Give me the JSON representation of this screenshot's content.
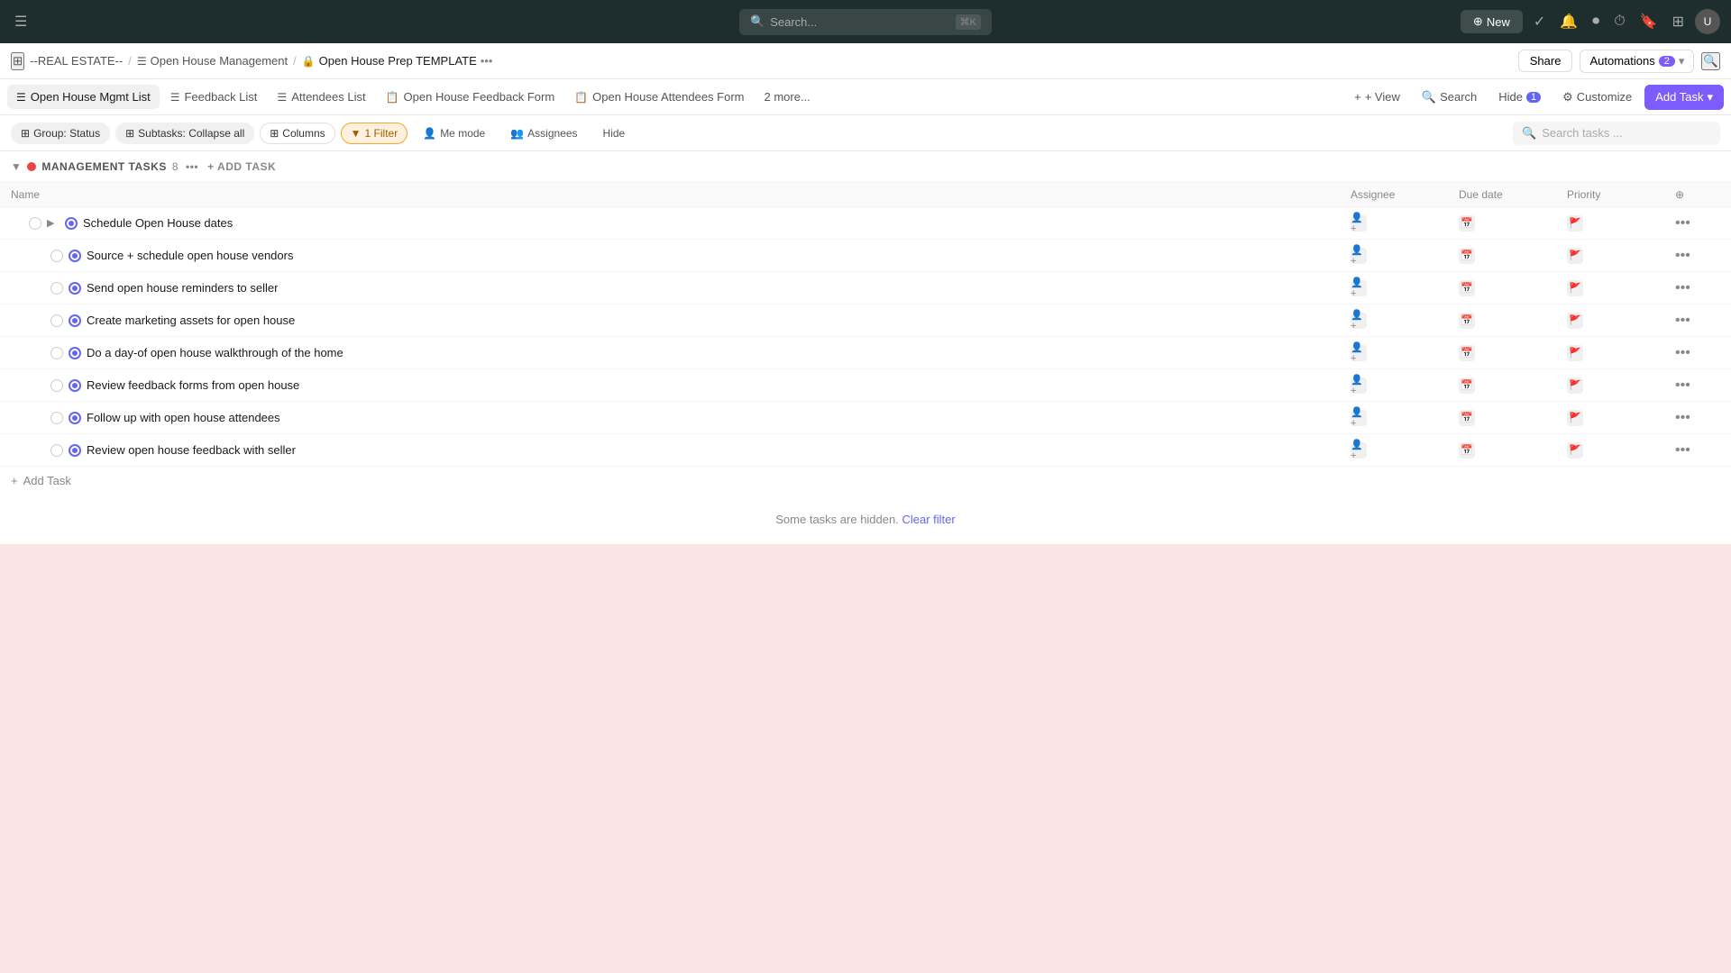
{
  "topNav": {
    "search_placeholder": "Search...",
    "search_shortcut": "⌘K",
    "new_label": "New",
    "icons": [
      "checkmark-icon",
      "notifications-icon",
      "record-icon",
      "timer-icon",
      "bookmark-icon",
      "grid-icon",
      "avatar-icon"
    ]
  },
  "breadcrumb": {
    "workspace": "--REAL ESTATE--",
    "list_icon": "list-icon",
    "section": "Open House Management",
    "lock_icon": "lock-icon",
    "current": "Open House Prep TEMPLATE",
    "more_icon": "ellipsis-icon",
    "share_label": "Share",
    "automations_label": "Automations",
    "automations_count": "2",
    "search_icon": "search-icon"
  },
  "tabs": [
    {
      "id": "mgmt-list",
      "label": "Open House Mgmt List",
      "icon": "list-icon",
      "active": true
    },
    {
      "id": "feedback-list",
      "label": "Feedback List",
      "icon": "list-icon",
      "active": false
    },
    {
      "id": "attendees-list",
      "label": "Attendees List",
      "icon": "list-icon",
      "active": false
    },
    {
      "id": "feedback-form",
      "label": "Open House Feedback Form",
      "icon": "form-icon",
      "active": false
    },
    {
      "id": "attendees-form",
      "label": "Open House Attendees Form",
      "icon": "form-icon",
      "active": false
    },
    {
      "id": "more",
      "label": "2 more...",
      "icon": null,
      "active": false
    }
  ],
  "tabActions": {
    "view_label": "+ View",
    "search_label": "Search",
    "hide_label": "Hide",
    "hide_count": "1",
    "customize_label": "Customize",
    "add_task_label": "Add Task"
  },
  "filterBar": {
    "group_label": "Group: Status",
    "subtasks_label": "Subtasks: Collapse all",
    "columns_label": "Columns",
    "filter_label": "1 Filter",
    "me_mode_label": "Me mode",
    "assignees_label": "Assignees",
    "hide_label": "Hide",
    "search_placeholder": "Search tasks ..."
  },
  "section": {
    "label": "MANAGEMENT TASKS",
    "count": "8",
    "add_label": "Add Task"
  },
  "columns": {
    "name": "Name",
    "assignee": "Assignee",
    "duedate": "Due date",
    "priority": "Priority"
  },
  "tasks": [
    {
      "id": 1,
      "name": "Schedule Open House dates",
      "isParent": true,
      "indent": 0
    },
    {
      "id": 2,
      "name": "Source + schedule open house vendors",
      "isParent": false,
      "indent": 1
    },
    {
      "id": 3,
      "name": "Send open house reminders to seller",
      "isParent": false,
      "indent": 1
    },
    {
      "id": 4,
      "name": "Create marketing assets for open house",
      "isParent": false,
      "indent": 1
    },
    {
      "id": 5,
      "name": "Do a day-of open house walkthrough of the home",
      "isParent": false,
      "indent": 1
    },
    {
      "id": 6,
      "name": "Review feedback forms from open house",
      "isParent": false,
      "indent": 1
    },
    {
      "id": 7,
      "name": "Follow up with open house attendees",
      "isParent": false,
      "indent": 1
    },
    {
      "id": 8,
      "name": "Review open house feedback with seller",
      "isParent": false,
      "indent": 1
    }
  ],
  "hiddenNotice": {
    "text": "Some tasks are hidden.",
    "link_label": "Clear filter"
  }
}
